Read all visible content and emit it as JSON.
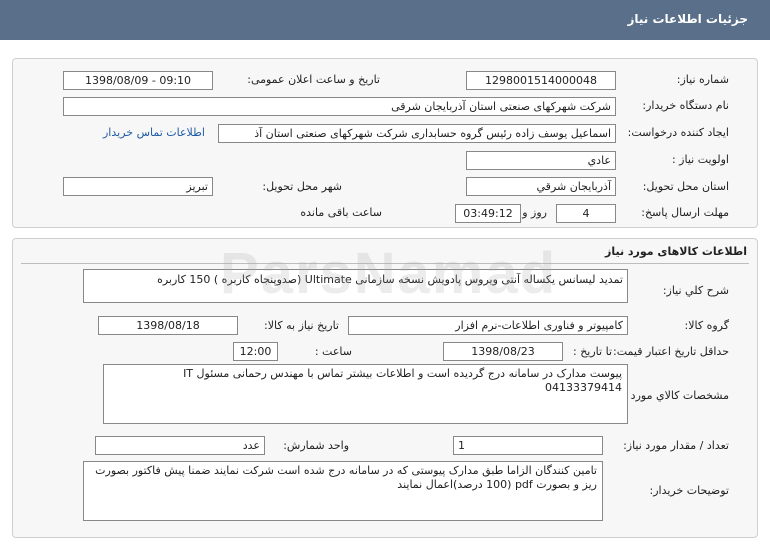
{
  "header": {
    "title": "جزئیات اطلاعات نیاز"
  },
  "info": {
    "need_number_label": "شماره نیاز:",
    "need_number": "1298001514000048",
    "announce_label": "تاریخ و ساعت اعلان عمومی:",
    "announce_value": "1398/08/09 - 09:10",
    "buyer_org_label": "نام دستگاه خریدار:",
    "buyer_org": "شرکت شهرکهای صنعتی استان آذربایجان شرقی",
    "creator_label": "ایجاد کننده درخواست:",
    "creator": "اسماعیل یوسف زاده رئیس گروه حسابداری شرکت شهرکهای صنعتی استان آذ",
    "contact_link": "اطلاعات تماس خریدار",
    "priority_label": "اولویت نیاز :",
    "priority": "عادي",
    "province_label": "استان محل تحویل:",
    "province": "آذربایجان شرقي",
    "city_label": "شهر محل تحویل:",
    "city": "تبريز",
    "deadline_label": "مهلت ارسال پاسخ:",
    "days": "4",
    "days_word": "روز و",
    "time_left": "03:49:12",
    "time_left_label": "ساعت باقی مانده"
  },
  "goods": {
    "section_title": "اطلاعات کالاهای مورد نیاز",
    "desc_label": "شرح کلي نیاز:",
    "desc": "تمدید لیسانس یکساله آنتی ویروس پادویش نسخه سازمانی Ultimate (صدوپنجاه کاربره ) 150 کاربره",
    "group_label": "گروه کالا:",
    "group": "کامپیوتر و فناوری اطلاعات-نرم افزار",
    "need_date_label": "تاریخ نیاز به کالا:",
    "need_date": "1398/08/18",
    "validity_label": "حداقل تاریخ اعتبار قیمت:",
    "validity_to": "تا تاریخ :",
    "validity_date": "1398/08/23",
    "hour_label": "ساعت :",
    "hour": "12:00",
    "specs_label": "مشخصات کالاي مورد نیاز:",
    "specs": "پیوست مدارک در سامانه درج گردیده است و اطلاعات بیشتر تماس با مهندس رحمانی مسئول IT 04133379414",
    "qty_label": "تعداد / مقدار مورد نیاز:",
    "qty": "1",
    "unit_label": "واحد شمارش:",
    "unit": "عدد",
    "buyer_notes_label": "توضیحات خریدار:",
    "buyer_notes": "تامین کنندگان الزاما طبق مدارک پیوستی که در سامانه درج شده است شرکت نمایند ضمنا پیش فاکتور بصورت ریز و بصورت pdf (100 درصد)اعمال نمایند"
  },
  "watermark": {
    "text": "ParsNamad"
  }
}
